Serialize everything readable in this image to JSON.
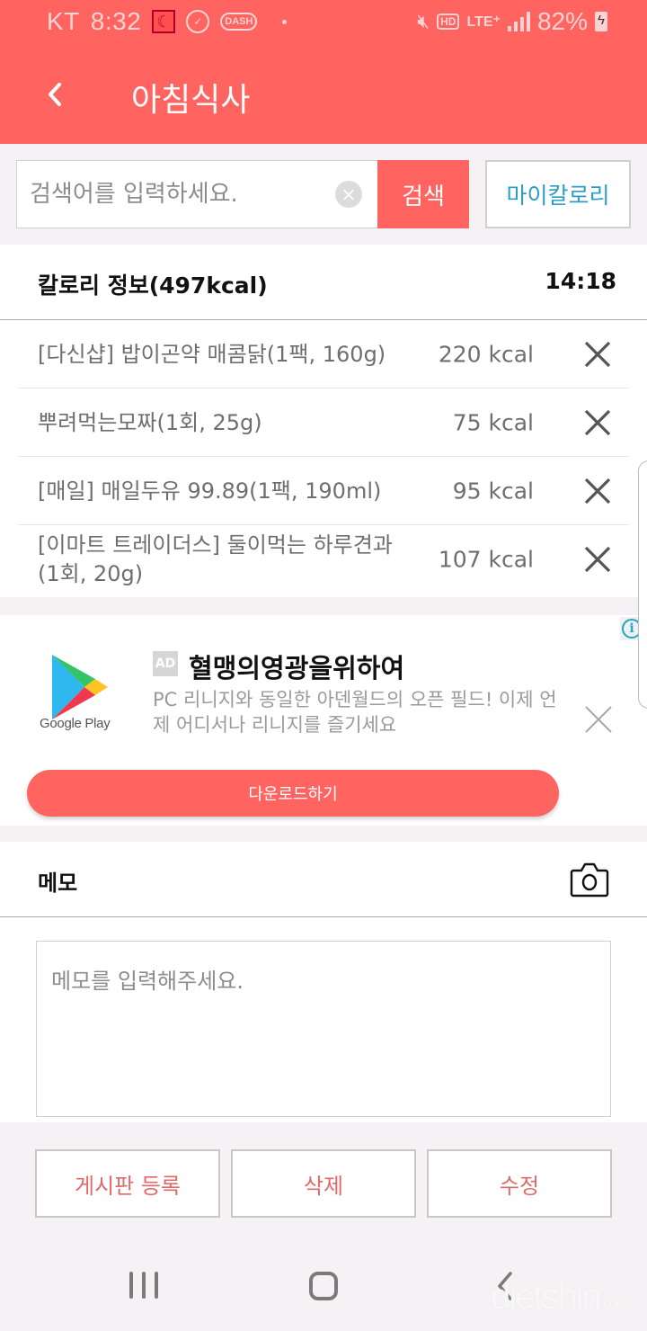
{
  "status_bar": {
    "carrier": "KT",
    "time": "8:32",
    "notification_icons": [
      "calendar-moon-icon",
      "stopwatch-icon",
      "dash-app-icon"
    ],
    "system_icons": [
      "mute-icon",
      "hd-voice-icon",
      "lte-plus-icon",
      "signal-icon"
    ],
    "hd_label": "HD",
    "network_label": "LTE⁺",
    "battery_percent": "82%",
    "battery_charging": true
  },
  "header": {
    "back_icon": "chevron-left-icon",
    "title": "아침식사"
  },
  "search": {
    "placeholder": "검색어를 입력하세요.",
    "value": "",
    "clear_icon": "clear-circle-icon",
    "clear_glyph": "×",
    "search_label": "검색",
    "my_calorie_label": "마이칼로리"
  },
  "calorie_info": {
    "title": "칼로리 정보(497kcal)",
    "time": "14:18",
    "items": [
      {
        "name": "[다신샵] 밥이곤약 매콤닭(1팩, 160g)",
        "kcal": "220 kcal"
      },
      {
        "name": "뿌려먹는모짜(1회, 25g)",
        "kcal": "75 kcal"
      },
      {
        "name": "[매일] 매일두유 99.89(1팩, 190ml)",
        "kcal": "95 kcal"
      },
      {
        "name": "[이마트 트레이더스] 둘이먹는 하루견과(1회, 20g)",
        "kcal": "107 kcal"
      }
    ]
  },
  "ad": {
    "info_glyph": "i",
    "brand": "Google Play",
    "badge": "AD",
    "title": "혈맹의영광을위하여",
    "description": "PC 리니지와 동일한 아덴월드의 오픈 필드! 이제 언제 어디서나 리니지를 즐기세요",
    "cta": "다운로드하기"
  },
  "memo": {
    "title": "메모",
    "camera_icon": "camera-icon",
    "placeholder": "메모를 입력해주세요.",
    "value": ""
  },
  "actions": {
    "post_label": "게시판 등록",
    "delete_label": "삭제",
    "edit_label": "수정"
  },
  "nav_bar": {
    "recent_icon": "recent-apps-icon",
    "home_icon": "home-icon",
    "back_icon": "back-icon"
  },
  "watermark": {
    "text": "dietshin",
    "suffix": ".com"
  },
  "colors": {
    "brand": "#ff6461",
    "link": "#2b9fc3",
    "action_text": "#e06a6a"
  }
}
